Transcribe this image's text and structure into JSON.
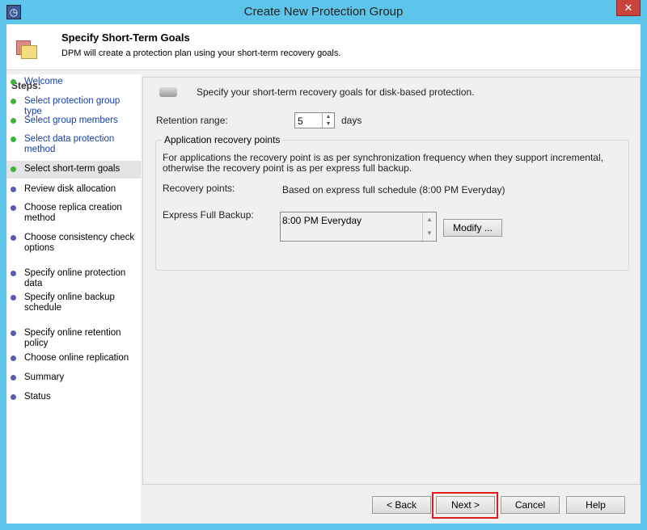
{
  "window": {
    "title": "Create New Protection Group",
    "close": "✕",
    "app_icon": "clock-icon"
  },
  "header": {
    "title": "Specify Short-Term Goals",
    "subtitle": "DPM will create a protection plan using your short-term recovery goals."
  },
  "steps": {
    "heading": "Steps:",
    "items": [
      {
        "label": "Welcome",
        "state": "done"
      },
      {
        "label": "Select protection group type",
        "state": "done"
      },
      {
        "label": "Select group members",
        "state": "done"
      },
      {
        "label": "Select data protection method",
        "state": "done"
      },
      {
        "label": "Select short-term goals",
        "state": "active"
      },
      {
        "label": "Review disk allocation",
        "state": "pending"
      },
      {
        "label": "Choose replica creation method",
        "state": "pending"
      },
      {
        "label": "Choose consistency check options",
        "state": "pending"
      },
      {
        "label": "Specify online protection data",
        "state": "pending"
      },
      {
        "label": "Specify online backup schedule",
        "state": "pending"
      },
      {
        "label": "Specify online retention policy",
        "state": "pending"
      },
      {
        "label": "Choose online replication",
        "state": "pending"
      },
      {
        "label": "Summary",
        "state": "pending"
      },
      {
        "label": "Status",
        "state": "pending"
      }
    ],
    "colors": {
      "done_dot": "#3cb43c",
      "pending_dot": "#5b5bb8"
    }
  },
  "main": {
    "intro": "Specify your short-term recovery goals for disk-based protection.",
    "retention_label": "Retention range:",
    "retention_value": "5",
    "retention_unit": "days",
    "group_title": "Application recovery points",
    "group_desc": "For applications the recovery point is as per synchronization frequency when they support incremental, otherwise the recovery point is as per express full backup.",
    "recovery_points_label": "Recovery points:",
    "recovery_points_value": "Based on express full schedule (8:00 PM Everyday)",
    "express_label": "Express Full Backup:",
    "express_items": [
      "8:00 PM Everyday"
    ],
    "modify": "Modify ..."
  },
  "buttons": {
    "back": "< Back",
    "next": "Next >",
    "cancel": "Cancel",
    "help": "Help"
  }
}
